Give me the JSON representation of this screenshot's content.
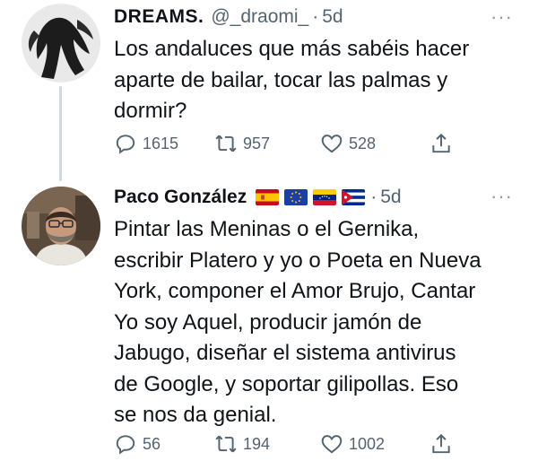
{
  "tweets": [
    {
      "display_name": "DREAMS.",
      "handle": "@_draomi_",
      "separator": "·",
      "time": "5d",
      "more": "···",
      "text": "Los andaluces que más sabéis hacer\naparte de bailar, tocar las palmas y\ndormir?",
      "replies": "1615",
      "retweets": "957",
      "likes": "528"
    },
    {
      "display_name": "Paco González",
      "flags": [
        "spain-flag-icon",
        "eu-flag-icon",
        "venezuela-flag-icon",
        "cuba-flag-icon"
      ],
      "separator": "·",
      "time": "5d",
      "more": "···",
      "text": "Pintar las Meninas o el Gernika,\nescribir Platero y yo o Poeta en Nueva\nYork, componer el Amor Brujo, Cantar\nYo soy Aquel, producir jamón de\nJabugo, diseñar el sistema antivirus\nde Google, y soportar gilipollas. Eso\nse nos da genial.",
      "replies": "56",
      "retweets": "194",
      "likes": "1002"
    }
  ],
  "colors": {
    "text": "#0f1419",
    "secondary": "#536471",
    "thread_line": "#cfd9de"
  }
}
